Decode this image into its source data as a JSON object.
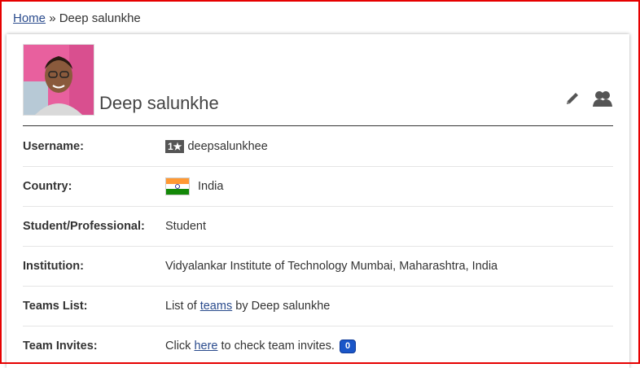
{
  "breadcrumb": {
    "home": "Home",
    "separator": "»",
    "current": "Deep salunkhe"
  },
  "profile": {
    "name": "Deep salunkhe",
    "avatar_alt": "profile photo",
    "icons": [
      "pencil-icon",
      "users-icon"
    ]
  },
  "details": {
    "username_label": "Username:",
    "rating_badge": "1★",
    "username": "deepsalunkhee",
    "country_label": "Country:",
    "country": "India",
    "student_label": "Student/Professional:",
    "student": "Student",
    "institution_label": "Institution:",
    "institution": "Vidyalankar Institute of Technology Mumbai, Maharashtra, India",
    "teams_label": "Teams List:",
    "teams_prefix": "List of",
    "teams_link": "teams",
    "teams_suffix": "by Deep salunkhe",
    "invites_label": "Team Invites:",
    "invites_prefix": "Click",
    "invites_link": "here",
    "invites_suffix": "to check team invites.",
    "invites_count": "0"
  },
  "colors": {
    "link": "#2a4b8d",
    "badge": "#1a56c8",
    "frame": "#e60000"
  }
}
